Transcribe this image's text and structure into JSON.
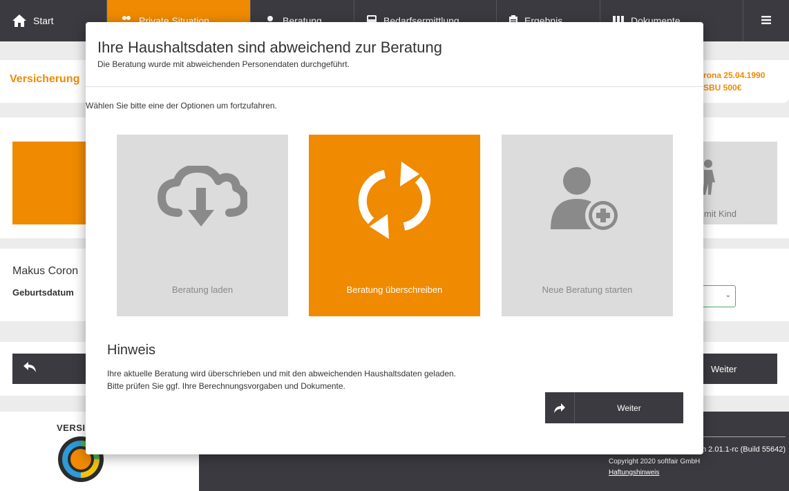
{
  "nav": {
    "start": "Start",
    "private": "Private Situation",
    "beratung": "Beratung",
    "bedarf": "Bedarfsermittlung",
    "ergebnis": "Ergebnis",
    "dokumente": "Dokumente"
  },
  "background": {
    "info_left": "Versicherung",
    "info_right_line1": "rona 25.04.1990",
    "info_right_line2": "SBU 500€",
    "tile_partial_label": "mit Kind",
    "person_name": "Makus Coron",
    "birthdate_label": "Geburtsdatum",
    "weiter_label": "Weiter"
  },
  "footer": {
    "logo_text": "VERSI",
    "version": "n 2.01.1-rc (Build 55642)",
    "copyright": "Copyright 2020 softfair GmbH",
    "link": "Haftungshinweis"
  },
  "modal": {
    "title": "Ihre Haushaltsdaten sind abweichend zur Beratung",
    "subtitle": "Die Beratung wurde mit abweichenden Personendaten durchgeführt.",
    "instruction": "Wählen Sie bitte eine der Optionen um fortzufahren.",
    "options": [
      {
        "label": "Beratung laden",
        "icon": "cloud-download-icon"
      },
      {
        "label": "Beratung überschreiben",
        "icon": "refresh-icon"
      },
      {
        "label": "Neue Beratung starten",
        "icon": "add-user-icon"
      }
    ],
    "hint_title": "Hinweis",
    "hint_line1": "Ihre aktuelle Beratung wird überschrieben und mit den abweichenden Haushaltsdaten geladen.",
    "hint_line2": "Bitte prüfen Sie ggf. Ihre Berechnungsvorgaben und Dokumente.",
    "weiter_label": "Weiter"
  },
  "colors": {
    "accent": "#f08a00",
    "dark": "#3a3a40",
    "tile_grey": "#dcdcdc"
  }
}
